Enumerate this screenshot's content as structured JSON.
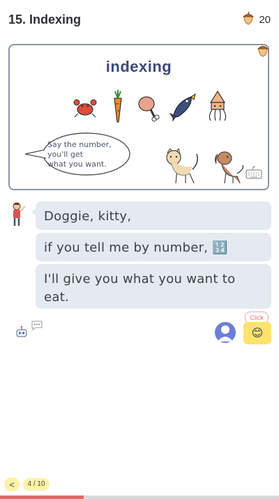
{
  "header": {
    "lesson_title": "15. Indexing",
    "acorn_count": "20",
    "acorn_icon": "acorn-icon"
  },
  "card": {
    "title": "indexing",
    "speech": "Say the number,\nyou'll get\nwhat you want.",
    "food_icons": [
      "crab-icon",
      "carrot-icon",
      "drumstick-icon",
      "fish-icon",
      "squid-icon"
    ],
    "animal_icons": [
      "cat-icon",
      "dog-icon"
    ]
  },
  "chat": {
    "messages": [
      "Doggie, kitty,",
      "if you tell me by number, 🔢",
      "I'll give you what you want to eat."
    ]
  },
  "actions": {
    "click_tag": "Click",
    "react_emoji": "😊"
  },
  "footer": {
    "prev_label": "<",
    "page_indicator": "4 / 10",
    "progress": 0.3,
    "progress_color": "#e06b6b"
  }
}
